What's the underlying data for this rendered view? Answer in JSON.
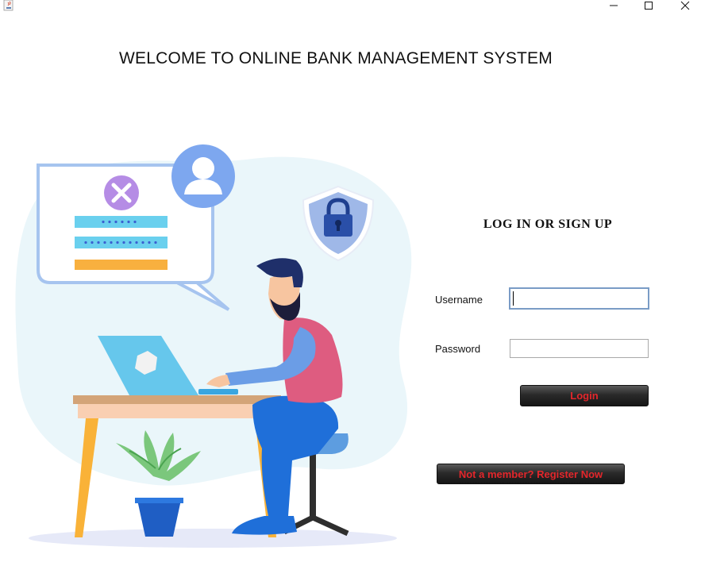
{
  "window": {
    "app_icon": "java-coffee-cup-icon",
    "controls": {
      "minimize_icon": "minimize-icon",
      "maximize_icon": "maximize-icon",
      "close_icon": "close-icon"
    }
  },
  "header": {
    "title": "WELCOME TO ONLINE BANK MANAGEMENT SYSTEM"
  },
  "illustration": {
    "description_icon": "login-illustration-icon"
  },
  "login_form": {
    "title": "LOG IN OR SIGN UP",
    "username_label": "Username",
    "username_value": "",
    "password_label": "Password",
    "password_value": "",
    "login_button": "Login",
    "register_button": "Not a member? Register Now"
  },
  "colors": {
    "button_text": "#e3262b",
    "button_bg": "#2a2a2a",
    "focused_field_border": "#7a9cc6"
  }
}
